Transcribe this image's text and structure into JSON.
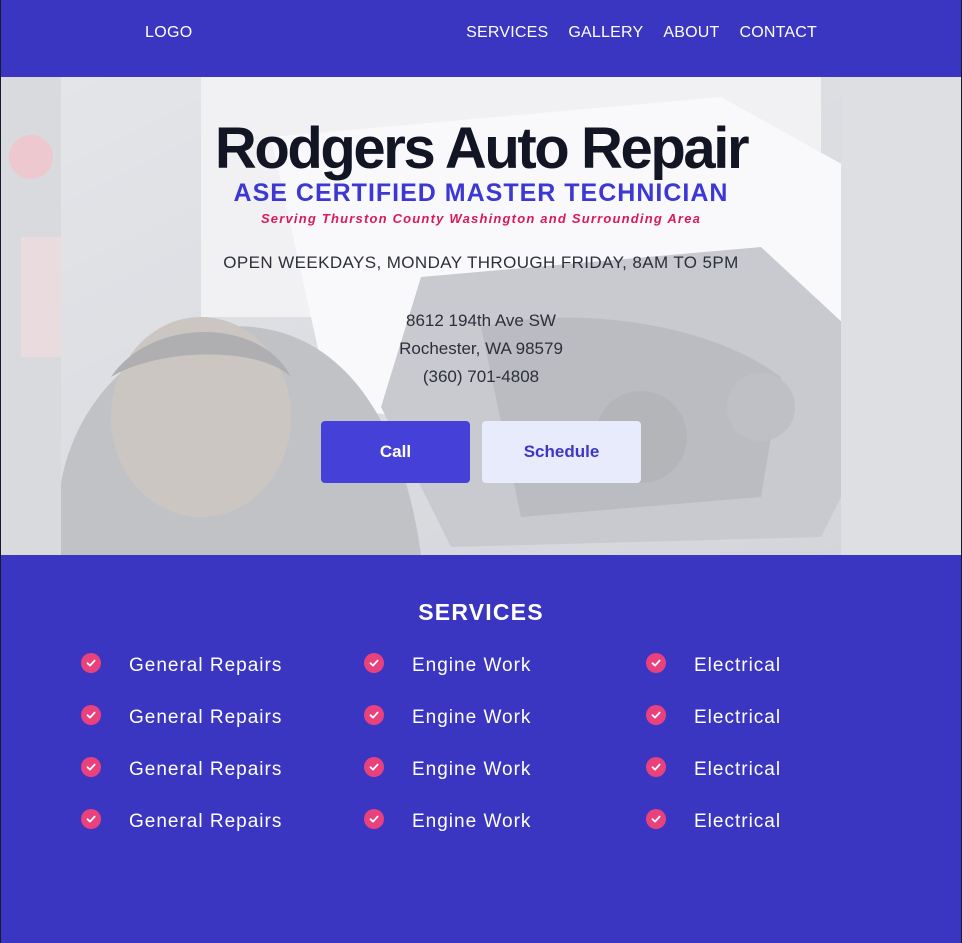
{
  "header": {
    "logo": "LOGO",
    "nav": [
      "SERVICES",
      "GALLERY",
      "ABOUT",
      "CONTACT"
    ]
  },
  "hero": {
    "title": "Rodgers Auto Repair",
    "subtitle": "ASE CERTIFIED MASTER TECHNICIAN",
    "tagline": "Serving Thurston County Washington and Surrounding Area",
    "hours": "OPEN WEEKDAYS, MONDAY THROUGH FRIDAY, 8AM TO 5PM",
    "address_line1": "8612 194th Ave SW",
    "address_line2": "Rochester, WA 98579",
    "phone": "(360) 701-4808",
    "call_label": "Call",
    "schedule_label": "Schedule"
  },
  "services": {
    "title": "SERVICES",
    "rows": [
      [
        "General Repairs",
        "Engine Work",
        "Electrical"
      ],
      [
        "General Repairs",
        "Engine Work",
        "Electrical"
      ],
      [
        "General Repairs",
        "Engine Work",
        "Electrical"
      ],
      [
        "General Repairs",
        "Engine Work",
        "Electrical"
      ]
    ],
    "icon": "check-circle-icon"
  },
  "colors": {
    "brand": "#3a36c2",
    "accent": "#e8417c",
    "button": "#4540d8",
    "title_text": "#121524",
    "subtitle_text": "#3d37d4",
    "tagline_text": "#d8195c"
  }
}
